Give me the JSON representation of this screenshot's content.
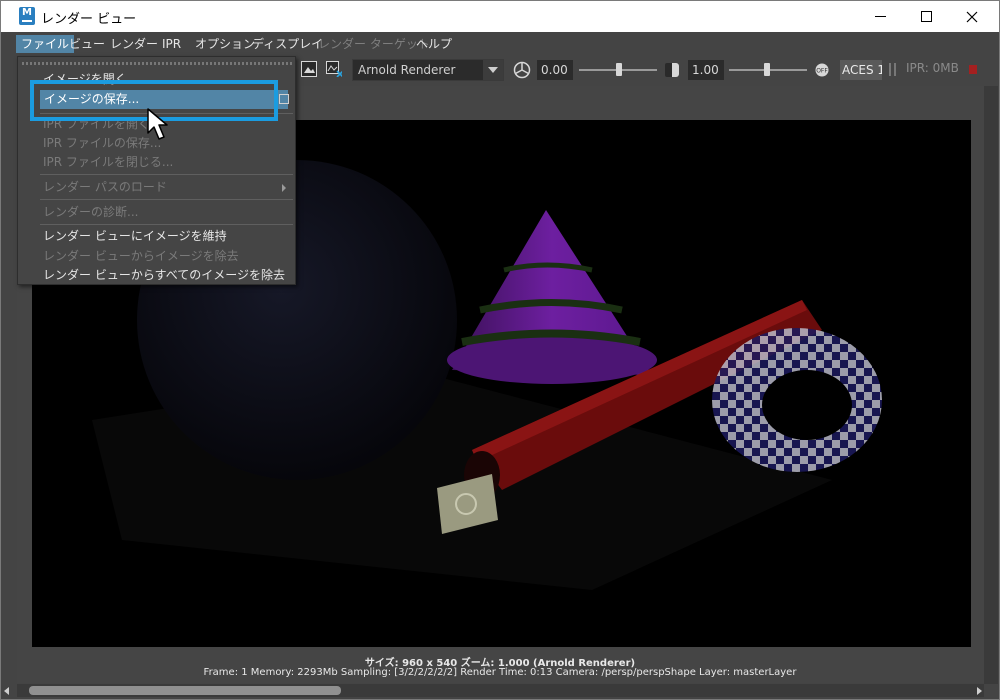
{
  "window": {
    "title": "レンダー ビュー",
    "app_icon_letter": "M"
  },
  "menubar": [
    {
      "label": "ファイル",
      "state": "active"
    },
    {
      "label": "ビュー",
      "state": "normal"
    },
    {
      "label": "レンダー",
      "state": "normal"
    },
    {
      "label": "IPR",
      "state": "normal"
    },
    {
      "label": "オプション",
      "state": "normal"
    },
    {
      "label": "ディスプレイ",
      "state": "normal"
    },
    {
      "label": "レンダー ターゲット",
      "state": "disabled"
    },
    {
      "label": "ヘルプ",
      "state": "normal"
    }
  ],
  "toolbar": {
    "renderer": "Arnold Renderer",
    "exposure": "0.00",
    "gamma": "1.00",
    "colorspace": "ACES 1",
    "ipr_status": "IPR: 0MB"
  },
  "file_menu": {
    "items": [
      {
        "label": "イメージを開く...",
        "enabled": true
      },
      {
        "label": "イメージの保存...",
        "enabled": true,
        "highlighted": true
      },
      {
        "label": "IPR ファイルを開く...",
        "enabled": false
      },
      {
        "label": "IPR ファイルの保存...",
        "enabled": false
      },
      {
        "label": "IPR ファイルを閉じる...",
        "enabled": false
      },
      {
        "label": "レンダー パスのロード",
        "enabled": false,
        "submenu": true
      },
      {
        "label": "レンダーの診断...",
        "enabled": false
      },
      {
        "label": "レンダー ビューにイメージを維持",
        "enabled": true
      },
      {
        "label": "レンダー ビューからイメージを除去",
        "enabled": false
      },
      {
        "label": "レンダー ビューからすべてのイメージを除去",
        "enabled": true
      }
    ]
  },
  "status": {
    "line1": "サイズ: 960 x 540 ズーム: 1.000    (Arnold Renderer)",
    "line2": "Frame: 1    Memory: 2293Mb    Sampling: [3/2/2/2/2/2]    Render Time: 0:13    Camera: /persp/perspShape    Layer: masterLayer"
  },
  "colors": {
    "menu_highlight": "#5285a6",
    "callout_border": "#1b9ce0",
    "ui_background": "#444444"
  }
}
